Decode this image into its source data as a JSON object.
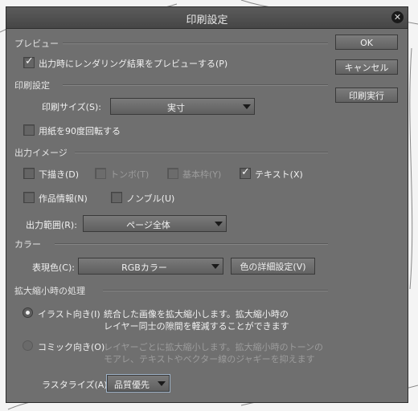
{
  "window": {
    "title": "印刷設定"
  },
  "preview": {
    "section": "プレビュー",
    "on_output_label": "出力時にレンダリング結果をプレビューする(P)",
    "on_output_checked": true
  },
  "print_settings": {
    "section": "印刷設定",
    "size_label": "印刷サイズ(S):",
    "size_value": "実寸",
    "rotate_label": "用紙を90度回転する",
    "rotate_checked": false
  },
  "output_image": {
    "section": "出力イメージ",
    "draft_label": "下描き(D)",
    "trim_label": "トンボ(T)",
    "basic_frame_label": "基本枠(Y)",
    "text_label": "テキスト(X)",
    "work_info_label": "作品情報(N)",
    "nombre_label": "ノンブル(U)",
    "range_label": "出力範囲(R):",
    "range_value": "ページ全体"
  },
  "color": {
    "section": "カラー",
    "expression_label": "表現色(C):",
    "expression_value": "RGBカラー",
    "detail_button": "色の詳細設定(V)"
  },
  "scaling": {
    "section": "拡大縮小時の処理",
    "illust_label": "イラスト向き(I)",
    "illust_desc_1": "統合した画像を拡大縮小します。拡大縮小時の",
    "illust_desc_2": "レイヤー同士の隙間を軽減することができます",
    "comic_label": "コミック向き(O)",
    "comic_desc_1": "レイヤーごとに拡大縮小します。拡大縮小時のトーンの",
    "comic_desc_2": "モアレ、テキストやベクター線のジャギーを抑えます",
    "rasterize_label": "ラスタライズ(A):",
    "rasterize_value": "品質優先"
  },
  "buttons": {
    "ok": "OK",
    "cancel": "キャンセル",
    "print": "印刷実行"
  },
  "icons": [
    "close-icon",
    "checkmark-icon",
    "dropdown-arrow-icon",
    "radio-icon"
  ]
}
